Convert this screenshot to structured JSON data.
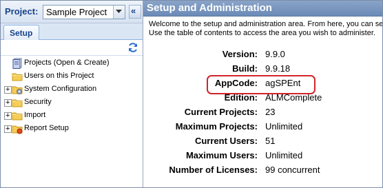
{
  "project_bar": {
    "label": "Project:",
    "selected_project": "Sample Project",
    "collapse_glyph": "«"
  },
  "tabs": [
    {
      "label": "Setup",
      "active": true
    }
  ],
  "toolbar": {
    "refresh_icon": "refresh-icon"
  },
  "tree": [
    {
      "label": "Projects (Open & Create)",
      "icon": "document-stack-icon",
      "expandable": false
    },
    {
      "label": "Users on this Project",
      "icon": "folder-icon",
      "expandable": false
    },
    {
      "label": "System Configuration",
      "icon": "config-folder-icon",
      "expandable": true
    },
    {
      "label": "Security",
      "icon": "folder-icon",
      "expandable": true
    },
    {
      "label": "Import",
      "icon": "folder-icon",
      "expandable": true
    },
    {
      "label": "Report Setup",
      "icon": "report-folder-icon",
      "expandable": true
    }
  ],
  "panel": {
    "title": "Setup and Administration",
    "intro_line1": "Welcome to the setup and administration area. From here, you can se",
    "intro_line2": "Use the table of contents to access the area you wish to administer."
  },
  "info": [
    {
      "key": "Version:",
      "value": "9.9.0"
    },
    {
      "key": "Build:",
      "value": "9.9.18"
    },
    {
      "key": "AppCode:",
      "value": "agSPEnt",
      "highlighted": true
    },
    {
      "key": "Edition:",
      "value": "ALMComplete"
    },
    {
      "key": "Current Projects:",
      "value": "23"
    },
    {
      "key": "Maximum Projects:",
      "value": "Unlimited"
    },
    {
      "key": "Current Users:",
      "value": "51"
    },
    {
      "key": "Maximum Users:",
      "value": "Unlimited"
    },
    {
      "key": "Number of Licenses:",
      "value": "99 concurrent"
    }
  ],
  "colors": {
    "header_blue": "#6b8ab7",
    "highlight_red": "#d2232a",
    "tab_text": "#15428b"
  }
}
